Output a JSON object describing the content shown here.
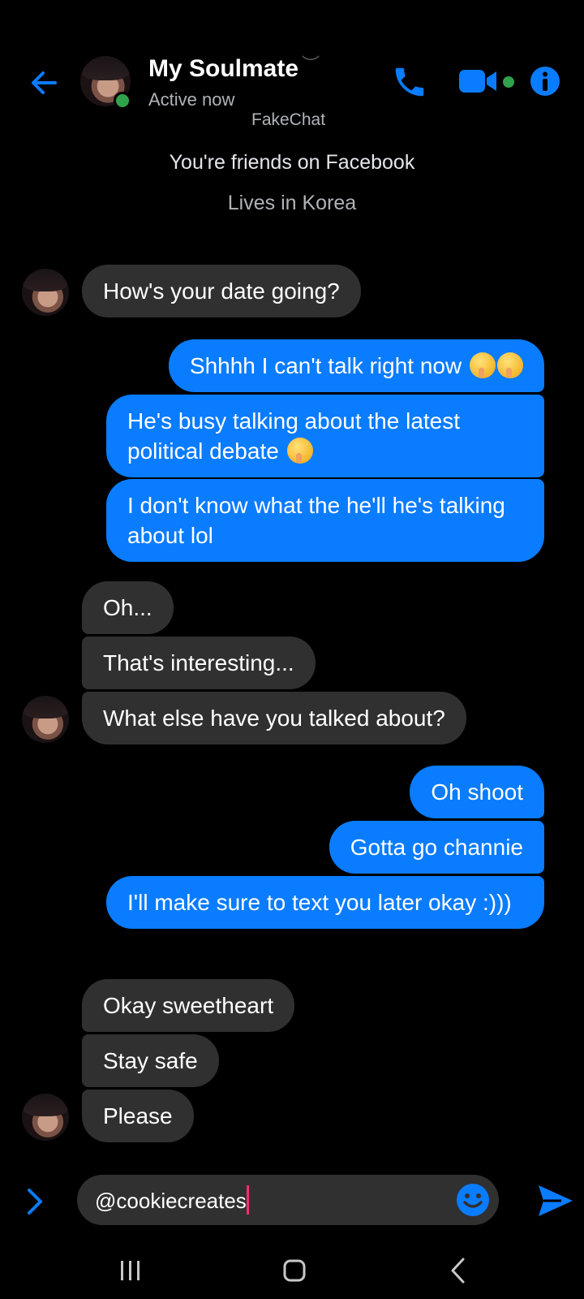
{
  "header": {
    "name": "My Soulmate",
    "status": "Active now",
    "accent": "#0a7cff",
    "online_color": "#31a24c"
  },
  "watermark": "FakeChat",
  "profile": {
    "friends": "You're friends on Facebook",
    "lives": "Lives in Korea"
  },
  "messages": [
    {
      "side": "in",
      "text": "How's your date going?"
    },
    {
      "side": "out",
      "text": "Shhhh I can't talk right now"
    },
    {
      "side": "out",
      "text": "He's busy talking about the latest political debate"
    },
    {
      "side": "out",
      "text": "I don't know what the he'll he's talking about lol"
    },
    {
      "side": "in",
      "text": "Oh..."
    },
    {
      "side": "in",
      "text": "That's interesting..."
    },
    {
      "side": "in",
      "text": "What else have you talked about?"
    },
    {
      "side": "out",
      "text": "Oh shoot"
    },
    {
      "side": "out",
      "text": "Gotta go channie"
    },
    {
      "side": "out",
      "text": "I'll make sure to text you later okay :)))"
    },
    {
      "side": "in",
      "text": "Okay sweetheart"
    },
    {
      "side": "in",
      "text": "Stay safe"
    },
    {
      "side": "in",
      "text": "Please"
    }
  ],
  "composer": {
    "value": "@cookiecreates"
  },
  "icons": {
    "back": "arrow-left-icon",
    "call": "phone-icon",
    "video": "video-camera-icon",
    "info": "info-icon",
    "emoji": "smiley-icon",
    "send": "send-icon",
    "expand": "chevron-right-icon"
  }
}
